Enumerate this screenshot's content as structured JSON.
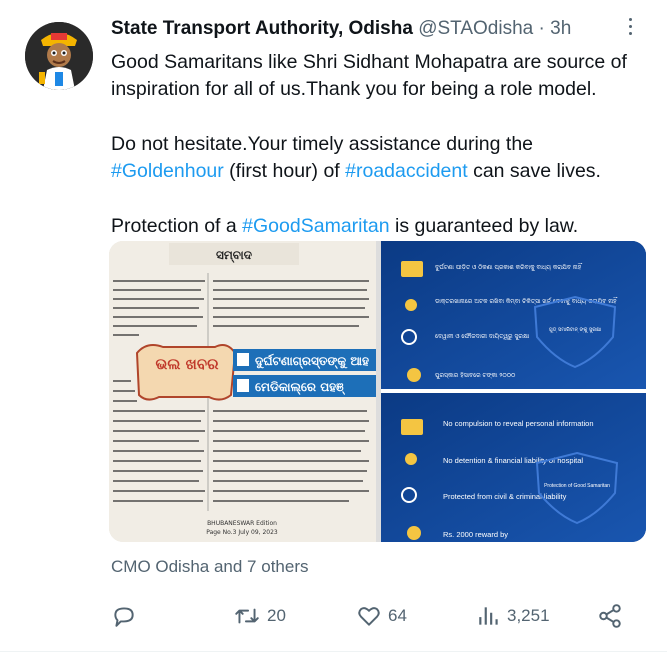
{
  "tweet": {
    "author_name": "State Transport Authority, Odisha",
    "handle": "@STAOdisha",
    "separator": "·",
    "time": "3h",
    "lines": [
      {
        "segments": [
          {
            "text": "Good Samaritans like Shri Sidhant Mohapatra are source of inspiration for all of us.Thank you for being a role model.",
            "tag": false
          }
        ]
      },
      {
        "segments": [
          {
            "text": "Do not hesitate.Your timely assistance during the ",
            "tag": false
          },
          {
            "text": "#Goldenhour",
            "tag": true
          },
          {
            "text": " (first hour) of ",
            "tag": false
          },
          {
            "text": "#roadaccident",
            "tag": true
          },
          {
            "text": " can save lives.",
            "tag": false
          }
        ]
      },
      {
        "segments": [
          {
            "text": "Protection of a ",
            "tag": false
          },
          {
            "text": "#GoodSamaritan",
            "tag": true
          },
          {
            "text": " is guaranteed by law.",
            "tag": false
          }
        ]
      }
    ],
    "liked_by": "CMO Odisha and 7 others",
    "actions": {
      "reply": {
        "icon": "reply-icon",
        "count": ""
      },
      "retweet": {
        "icon": "retweet-icon",
        "count": "20"
      },
      "like": {
        "icon": "heart-icon",
        "count": "64"
      },
      "views": {
        "icon": "views-icon",
        "count": "3,251"
      },
      "share": {
        "icon": "share-icon",
        "count": ""
      }
    }
  },
  "media": {
    "newspaper": {
      "masthead": "ସମ୍ବାଦ",
      "badge": "ଭଲ ଖବର",
      "banner_1": "ଦୁର୍ଘଟଣାଗ୍ରସ୍ତଙ୍କୁ ଆହ",
      "banner_2": "ମେଡିକାଲ୍‌ରେ ପହଞ୍",
      "footer_1": "BHUBANESWAR Edition",
      "footer_2": "Page No.3 July 09, 2023"
    },
    "infographic": {
      "top_items": [
        "ଦୁର୍ଘଟଣା ପୀଡ଼ିତ ଓ ଠିକଣା ପ୍ରକାଶ କରିବାକୁ ବାଧ୍ୟ କରାଯିବ ନାହିଁ",
        "ଡାକ୍ତରଖାନାରେ ଅଟକ ରଖିବା କିମ୍ବା ଚିକିତ୍ସା ଖର୍ଚ୍ଚ ଦେବାକୁ ବାଧ୍ୟ କରାଯିବ ନାହିଁ",
        "ଦେୱାନୀ ଓ ଫୌଜଦାରୀ ଦାୟିତ୍ୱରୁ ସୁରକ୍ଷା",
        "ପୁରସ୍କାର ହିସାବରେ ଟଙ୍କା ୨୦୦୦"
      ],
      "top_shield": "ଗୁଡ୍ ସମାରିଟାନ୍ ଙ୍କୁ ସୁରକ୍ଷା",
      "bottom_items": [
        "No compulsion to reveal personal information",
        "No detention & financial liability of hospital",
        "Protected from civil & criminal liability",
        "Rs. 2000 reward by"
      ],
      "bottom_shield": "Protection of Good Samaritan"
    }
  },
  "colors": {
    "hashtag": "#1d9bf0",
    "muted": "#536471",
    "text": "#0f1419",
    "infographic_bg": "#0f3f8a"
  }
}
